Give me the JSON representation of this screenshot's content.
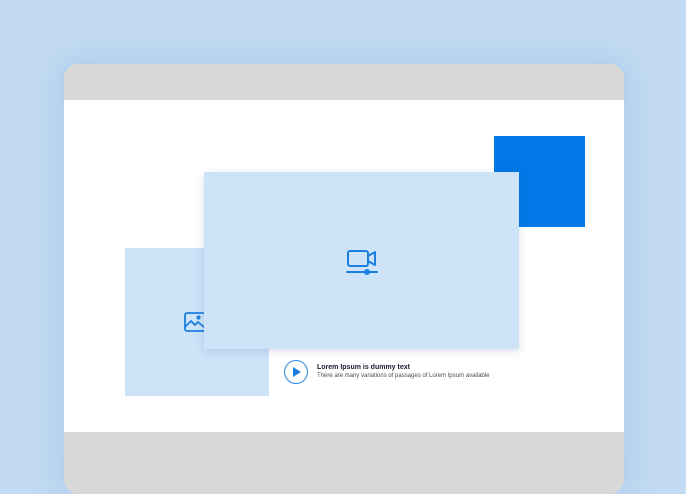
{
  "caption": {
    "title": "Lorem Ipsum is dummy text",
    "text": "There are many variations of passages of Lorem Ipsum available"
  },
  "colors": {
    "background": "#c3dbf2",
    "window_frame": "#d8d8d8",
    "content": "#ffffff",
    "card": "#cde3f8",
    "accent": "#0078e6",
    "icon": "#1a7fe0"
  },
  "icons": {
    "image": "image-icon",
    "video": "video-camera-icon",
    "play": "play-icon"
  }
}
